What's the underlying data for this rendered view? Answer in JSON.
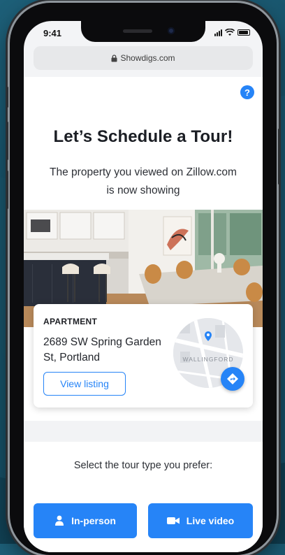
{
  "status_bar": {
    "time": "9:41"
  },
  "browser": {
    "url": "Showdigs.com"
  },
  "page": {
    "help_label": "?",
    "title": "Let’s Schedule a Tour!",
    "subtitle": "The property you viewed on Zillow.com is now showing"
  },
  "listing": {
    "type": "APARTMENT",
    "address": "2689 SW Spring Garden St, Portland",
    "view_button": "View listing",
    "map_label": "WALLINGFORD"
  },
  "tour": {
    "prompt": "Select the tour type you prefer:",
    "options": [
      {
        "label": "In-person",
        "icon": "person-icon"
      },
      {
        "label": "Live video",
        "icon": "video-camera-icon"
      }
    ]
  },
  "colors": {
    "accent": "#2684f7"
  }
}
